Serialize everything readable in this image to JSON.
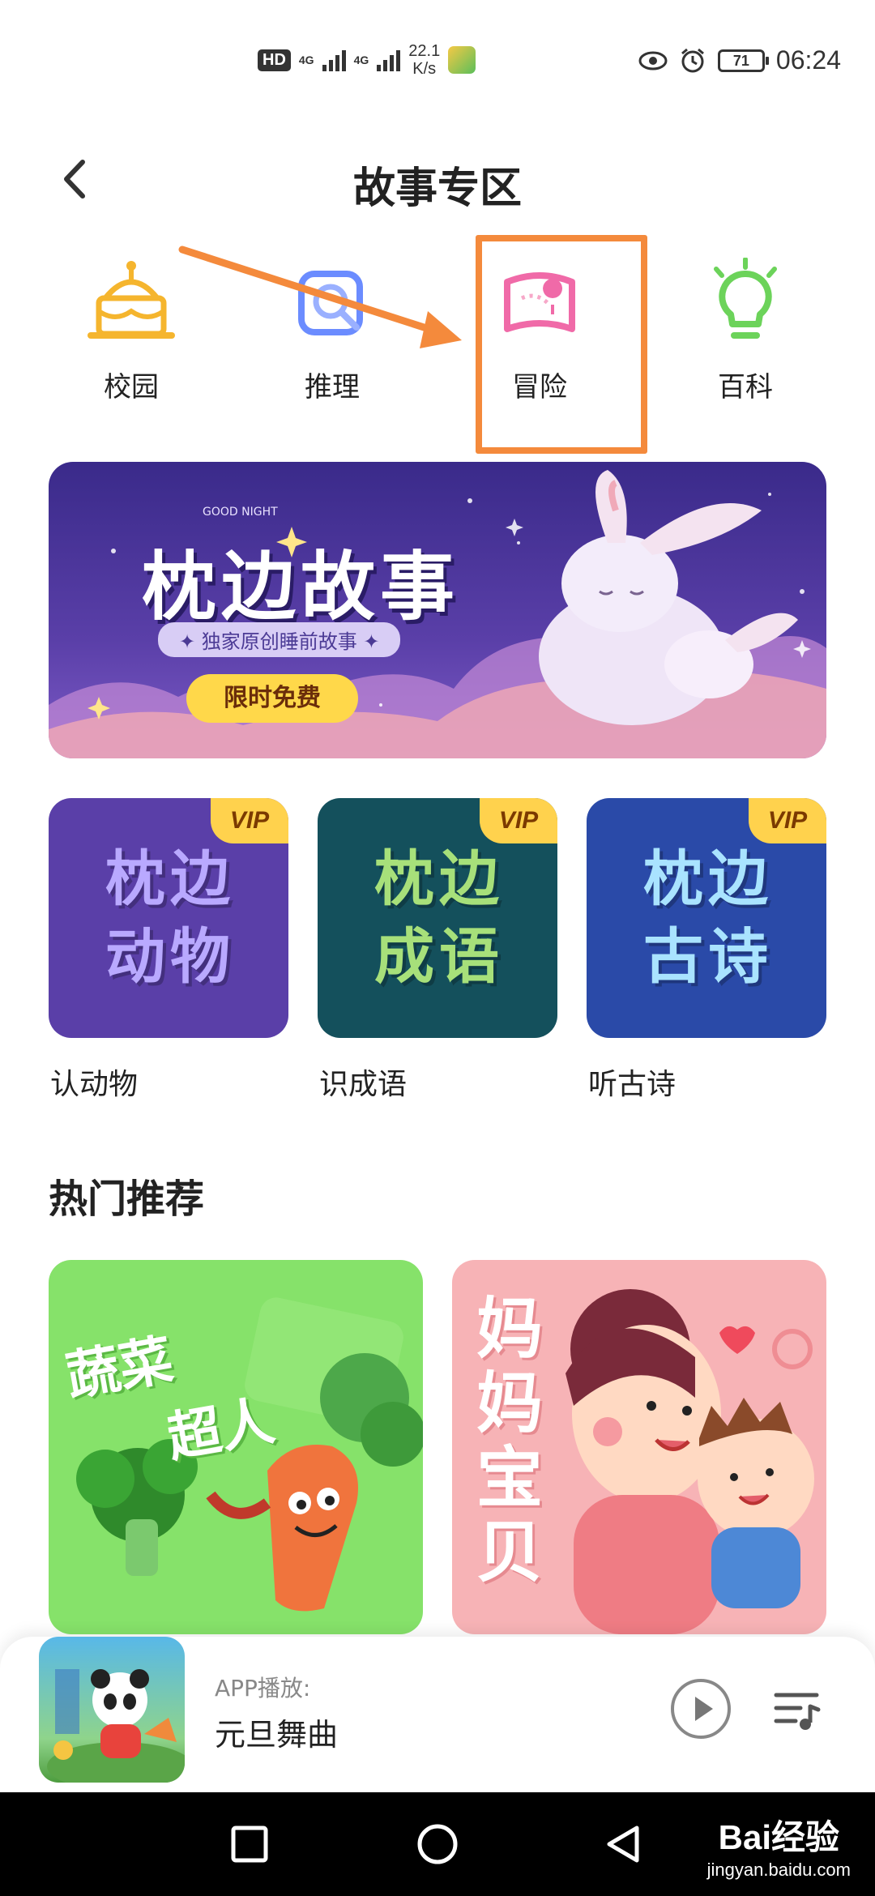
{
  "status_bar": {
    "hd_badge": "HD",
    "network_1": "4G",
    "network_2": "4G",
    "speed_value": "22.1",
    "speed_unit": "K/s",
    "battery": "71",
    "time": "06:24"
  },
  "header": {
    "title": "故事专区",
    "back_icon": "chevron-left-icon"
  },
  "categories": [
    {
      "label": "校园",
      "icon": "cake-icon",
      "color": "#f5b52e"
    },
    {
      "label": "推理",
      "icon": "magnifier-icon",
      "color": "#6b8cff"
    },
    {
      "label": "冒险",
      "icon": "map-pin-icon",
      "color": "#f06aa8"
    },
    {
      "label": "百科",
      "icon": "lightbulb-icon",
      "color": "#6cd35a"
    }
  ],
  "annotation": {
    "highlight_color": "#f48a3c"
  },
  "banner": {
    "title": "枕边故事",
    "tag": "GOOD NIGHT",
    "subtitle": "✦ 独家原创睡前故事 ✦",
    "button": "限时免费"
  },
  "vip_cards": [
    {
      "badge": "VIP",
      "art_line1": "枕边",
      "art_line2": "动物",
      "label": "认动物",
      "bg": "#5a3fa8",
      "text_color": "#b9a9ff"
    },
    {
      "badge": "VIP",
      "art_line1": "枕边",
      "art_line2": "成语",
      "label": "识成语",
      "bg": "#14505c",
      "text_color": "#a7e07a"
    },
    {
      "badge": "VIP",
      "art_line1": "枕边",
      "art_line2": "古诗",
      "label": "听古诗",
      "bg": "#2a4aa8",
      "text_color": "#a9e3ff"
    }
  ],
  "section": {
    "title": "热门推荐"
  },
  "recommendations": [
    {
      "title_line1": "蔬菜",
      "title_line2": "超人",
      "bg": "#86e26a"
    },
    {
      "title": "妈妈宝贝",
      "bg": "#f7b3b6"
    }
  ],
  "player": {
    "prefix": "APP播放:",
    "song": "元旦舞曲",
    "play_icon": "play-icon",
    "playlist_icon": "playlist-icon"
  },
  "nav": {
    "recent_icon": "square-icon",
    "home_icon": "circle-icon",
    "back_icon": "triangle-back-icon"
  },
  "watermark": {
    "main": "Bai经验",
    "sub": "jingyan.baidu.com"
  }
}
